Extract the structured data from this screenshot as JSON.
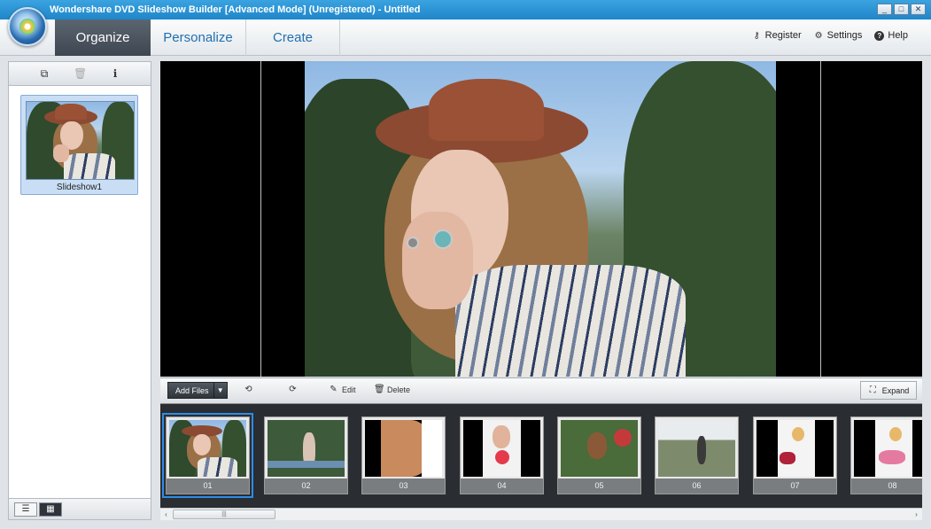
{
  "window": {
    "title": "Wondershare DVD Slideshow Builder [Advanced Mode] (Unregistered) - Untitled",
    "controls": [
      "_",
      "□",
      "✕"
    ]
  },
  "logo": {
    "icon": "app-logo-icon"
  },
  "tabs": [
    {
      "label": "Organize",
      "active": true
    },
    {
      "label": "Personalize",
      "active": false
    },
    {
      "label": "Create",
      "active": false
    }
  ],
  "top_actions": [
    {
      "label": "Register",
      "icon": "key-icon"
    },
    {
      "label": "Settings",
      "icon": "gear-icon"
    },
    {
      "label": "Help",
      "icon": "help-icon"
    }
  ],
  "left_panel": {
    "toolbar": [
      {
        "icon": "add-slideshow-icon",
        "glyph": "⧉"
      },
      {
        "icon": "trash-icon",
        "glyph": "🗑"
      },
      {
        "icon": "info-icon",
        "glyph": "ℹ"
      }
    ],
    "slideshows": [
      {
        "label": "Slideshow1",
        "selected": true
      }
    ],
    "view_buttons": [
      {
        "icon": "list-view-icon",
        "glyph": "☰",
        "active": false
      },
      {
        "icon": "thumbnail-view-icon",
        "glyph": "▦",
        "active": true
      }
    ]
  },
  "action_bar": {
    "add_files": "Add Files",
    "rotate_left_glyph": "⟲",
    "rotate_right_glyph": "⟳",
    "edit": "Edit",
    "delete": "Delete",
    "expand": "Expand"
  },
  "filmstrip": {
    "frames": [
      {
        "num": "01",
        "selected": true,
        "bg": "#5b7a4e"
      },
      {
        "num": "02",
        "selected": false,
        "bg": "#3d5a3a"
      },
      {
        "num": "03",
        "selected": false,
        "bg": "#c98a5e"
      },
      {
        "num": "04",
        "selected": false,
        "bg": "#f2f2f2"
      },
      {
        "num": "05",
        "selected": false,
        "bg": "#4a6b3a"
      },
      {
        "num": "06",
        "selected": false,
        "bg": "#7d8b6c"
      },
      {
        "num": "07",
        "selected": false,
        "bg": "#f4f4f4"
      },
      {
        "num": "08",
        "selected": false,
        "bg": "#f4f4f4"
      }
    ]
  },
  "scrollbar": {
    "left": "‹",
    "right": "›",
    "grip": "|||"
  }
}
